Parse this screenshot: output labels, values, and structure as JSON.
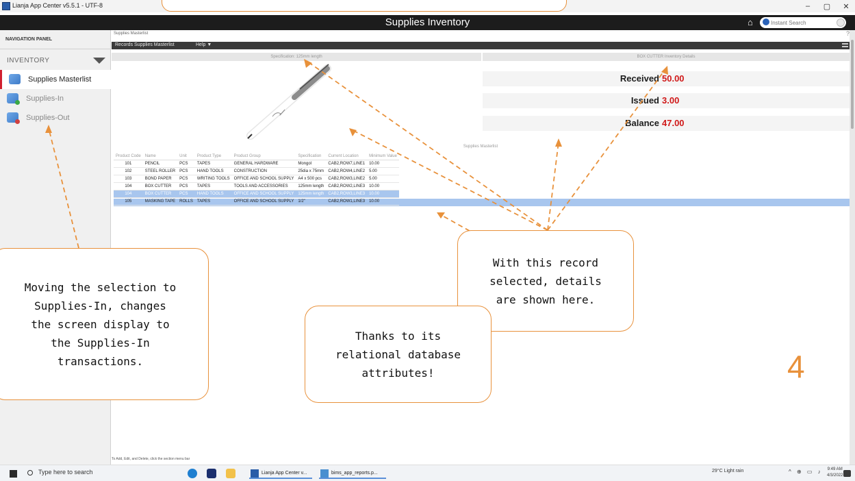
{
  "window": {
    "title": "Lianja App Center v5.5.1 - UTF-8",
    "controls": [
      "–",
      "▢",
      "✕"
    ]
  },
  "app_header": {
    "title": "Supplies Inventory",
    "search_placeholder": "Instant Search"
  },
  "sidebar": {
    "panel_label": "NAVIGATION PANEL",
    "section_label": "INVENTORY",
    "items": [
      {
        "label": "Supplies Masterlist",
        "icon": "supplies-masterlist-icon"
      },
      {
        "label": "Supplies-In",
        "icon": "supplies-in-icon"
      },
      {
        "label": "Supplies-Out",
        "icon": "supplies-out-icon"
      }
    ]
  },
  "main": {
    "breadcrumb": "Supplies Masterlist",
    "help_question": "?",
    "menu": {
      "records": "Records Supplies Masterlist",
      "help": "Help ▼"
    },
    "image_section_header": "Specification: 125mm length",
    "details_section_header": "BOX CUTTER Inventory Details",
    "details": [
      {
        "label": "Received",
        "value": "50.00"
      },
      {
        "label": "Issued",
        "value": "3.00"
      },
      {
        "label": "Balance",
        "value": "47.00"
      }
    ],
    "masterlist_header": "Supplies Masterlist",
    "table": {
      "columns": [
        "Product Code",
        "Name",
        "Unit",
        "Product Type",
        "Product Group",
        "Specification",
        "Current Location",
        "Minimum Value"
      ],
      "rows": [
        [
          "101",
          "PENCIL",
          "PCS",
          "TAPES",
          "GENERAL HARDWARE",
          "Mongol",
          "CAB2,ROW7,LINE1",
          "10.00"
        ],
        [
          "102",
          "STEEL ROLLER",
          "PCS",
          "HAND TOOLS",
          "CONSTRUCTION",
          "25dia x 75mm",
          "CAB2,ROW4,LINE2",
          "5.00"
        ],
        [
          "103",
          "BOND PAPER",
          "PCS",
          "WRITING TOOLS",
          "OFFICE AND SCHOOL SUPPLY",
          "A4 x 500 pcs",
          "CAB2,ROW3,LINE2",
          "5.00"
        ],
        [
          "104",
          "BOX CUTTER",
          "PCS",
          "TAPES",
          "TOOLS AND ACCESSORIES",
          "125mm length",
          "CAB2,ROW2,LINE3",
          "10.00"
        ],
        [
          "104",
          "BOX CUTTER",
          "PCS",
          "HAND TOOLS",
          "OFFICE AND SCHOOL SUPPLY",
          "125mm length",
          "CAB2,ROW3,LINE3",
          "10.00"
        ],
        [
          "105",
          "MASKING TAPE",
          "ROLLS",
          "TAPES",
          "OFFICE AND SCHOOL SUPPLY",
          "1/2\"",
          "CAB2,ROW1,LINE3",
          "10.00"
        ]
      ],
      "selected_row": 4
    },
    "status_text": "To Add, Edit, and Delete, click the section menu bar"
  },
  "annotations": {
    "callout_left": [
      "Moving the selection to",
      "Supplies-In, changes",
      "the screen display to",
      "the Supplies-In",
      "transactions."
    ],
    "callout_right": [
      "With this record",
      "selected, details",
      "are shown here."
    ],
    "callout_middle": [
      "Thanks to its",
      "relational database",
      "attributes!"
    ],
    "slide_number": "4",
    "accent_color": "#e8913b"
  },
  "taskbar": {
    "search_placeholder": "Type here to search",
    "windows": [
      {
        "label": "Lianja App Center v...",
        "icon": "lianja-icon"
      },
      {
        "label": "bims_app_reports.p...",
        "icon": "python-file-icon"
      }
    ],
    "weather": "29°C  Light rain",
    "time": "9:49 AM",
    "date": "4/3/2022"
  },
  "colors": {
    "header_bg": "#1c1c1c",
    "selection": "#a8c6ee",
    "value_red": "#d01919",
    "active_marker": "#d02030"
  }
}
